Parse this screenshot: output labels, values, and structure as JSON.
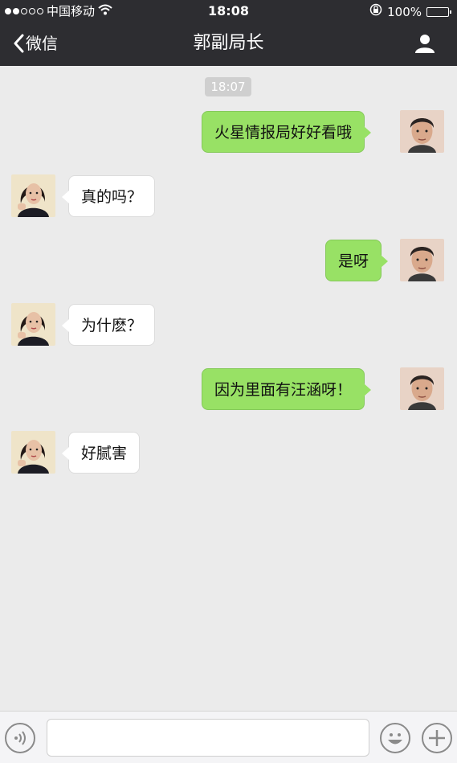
{
  "status_bar": {
    "carrier": "中国移动",
    "time": "18:08",
    "battery": "100%",
    "battery_level": 1.0,
    "signal_bars_filled": 2,
    "signal_bars_total": 5
  },
  "nav": {
    "back_label": "微信",
    "title": "郭副局长"
  },
  "chat": {
    "timestamp": "18:07",
    "messages": [
      {
        "side": "sent",
        "text": "火星情报局好好看哦"
      },
      {
        "side": "received",
        "text": "真的吗？"
      },
      {
        "side": "sent",
        "text": "是呀"
      },
      {
        "side": "received",
        "text": "为什麽？"
      },
      {
        "side": "sent",
        "text": "因为里面有汪涵呀！"
      },
      {
        "side": "received",
        "text": "好腻害"
      }
    ]
  },
  "input": {
    "placeholder": "",
    "value": ""
  },
  "colors": {
    "nav_bg": "#2d2d31",
    "chat_bg": "#ebebeb",
    "sent_bubble": "#98e165",
    "received_bubble": "#ffffff"
  },
  "icons": {
    "back": "chevron-left-icon",
    "profile": "person-icon",
    "voice": "voice-icon",
    "emoji": "emoji-icon",
    "more": "plus-icon",
    "wifi": "wifi-icon",
    "lock": "orientation-lock-icon",
    "battery": "battery-icon"
  }
}
